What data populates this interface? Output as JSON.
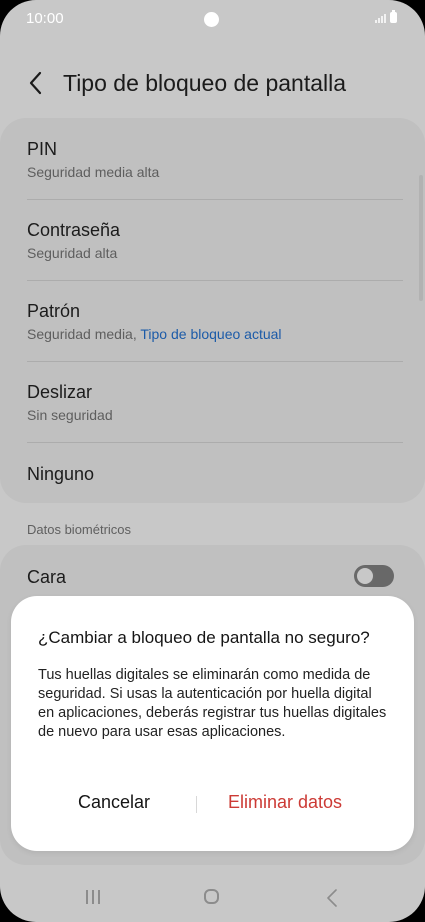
{
  "status_bar": {
    "time": "10:00"
  },
  "header": {
    "title": "Tipo de bloqueo de pantalla"
  },
  "lock_options": [
    {
      "title": "PIN",
      "subtitle": "Seguridad media alta"
    },
    {
      "title": "Contraseña",
      "subtitle": "Seguridad alta"
    },
    {
      "title": "Patrón",
      "subtitle": "Seguridad media, ",
      "subtitle_accent": "Tipo de bloqueo actual"
    },
    {
      "title": "Deslizar",
      "subtitle": "Sin seguridad"
    },
    {
      "title": "Ninguno"
    }
  ],
  "biometrics": {
    "section_label": "Datos biométricos",
    "face": {
      "label": "Cara",
      "enabled": false
    }
  },
  "dialog": {
    "title": "¿Cambiar a bloqueo de pantalla no seguro?",
    "body": "Tus huellas digitales se eliminarán como medida de seguridad. Si usas la autenticación por huella digital en aplicaciones, deberás registrar tus huellas digitales de nuevo para usar esas aplicaciones.",
    "cancel_label": "Cancelar",
    "confirm_label": "Eliminar datos"
  },
  "colors": {
    "accent_link": "#1c5ba8",
    "destructive": "#cc3a35"
  }
}
